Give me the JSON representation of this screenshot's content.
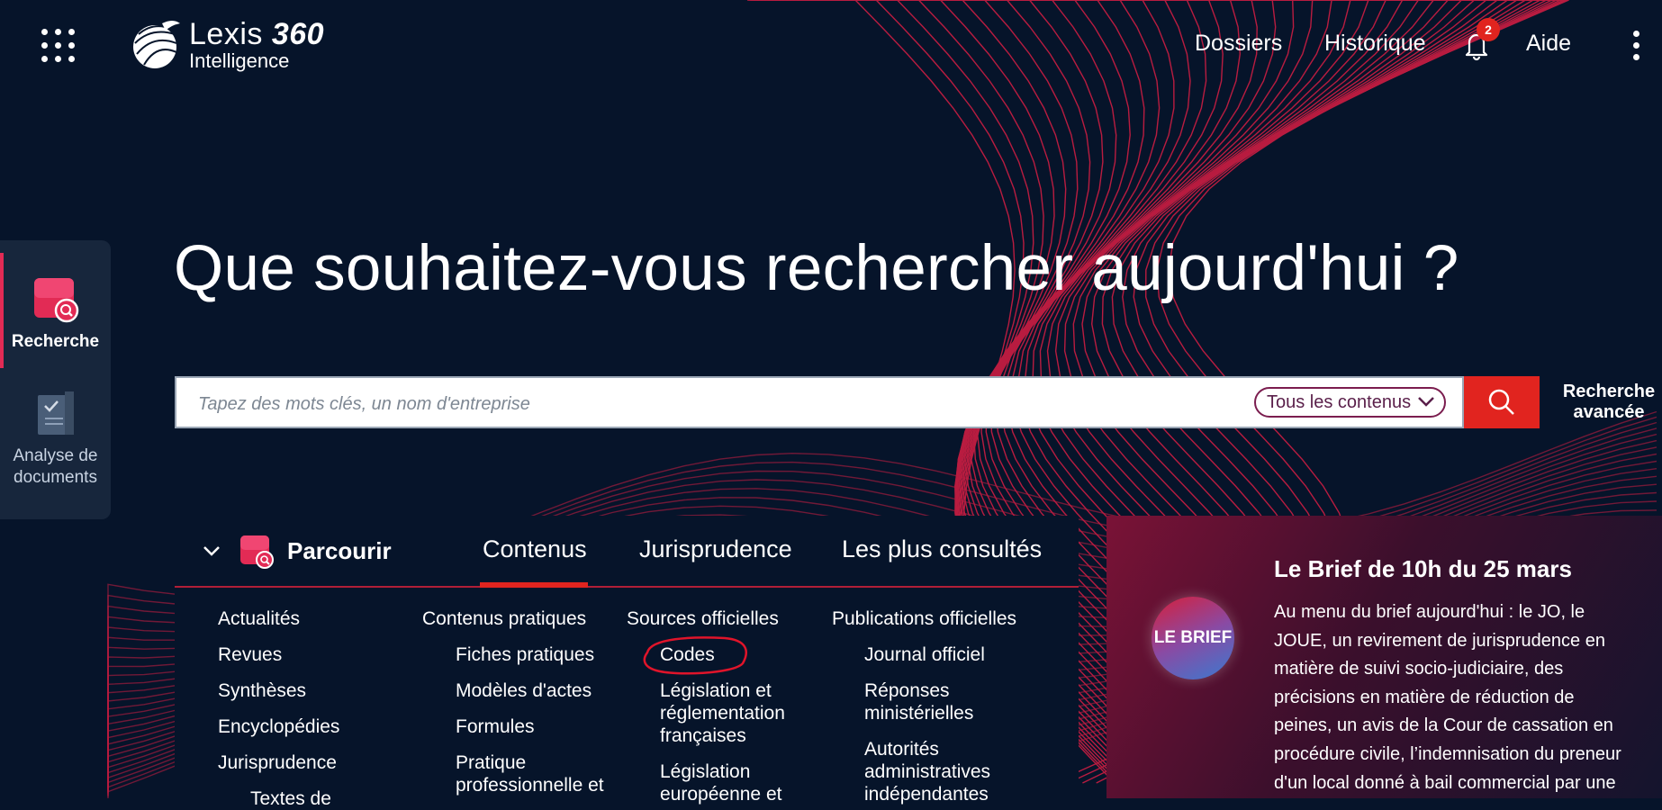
{
  "app": {
    "brand_name": "Lexis",
    "brand_num": "360",
    "brand_sub": "Intelligence"
  },
  "nav": {
    "dossiers": "Dossiers",
    "historique": "Historique",
    "notifications_count": "2",
    "aide": "Aide"
  },
  "sidebar": {
    "items": [
      {
        "label": "Recherche",
        "icon": "search-doc-icon",
        "active": true
      },
      {
        "label_line1": "Analyse de",
        "label_line2": "documents",
        "icon": "document-check-icon",
        "active": false
      }
    ]
  },
  "hero": {
    "headline": "Que souhaitez-vous rechercher aujourd'hui ?"
  },
  "search": {
    "placeholder": "Tapez des mots clés, un nom d'entreprise",
    "scope": "Tous les contenus",
    "advanced_line1": "Recherche",
    "advanced_line2": "avancée"
  },
  "browse": {
    "title": "Parcourir",
    "tabs": [
      {
        "label": "Contenus",
        "active": true
      },
      {
        "label": "Jurisprudence",
        "active": false
      },
      {
        "label": "Les plus consultés",
        "active": false
      }
    ],
    "columns": [
      {
        "items": [
          "Actualités",
          "Revues",
          "Synthèses",
          "Encyclopédies",
          "Jurisprudence",
          "Textes de"
        ]
      },
      {
        "heading": "Contenus pratiques",
        "items": [
          "Fiches pratiques",
          "Modèles d'actes",
          "Formules",
          "Pratique",
          "professionnelle et"
        ]
      },
      {
        "heading": "Sources officielles",
        "items": [
          "Codes",
          "Législation et",
          "réglementation",
          "françaises",
          "Législation",
          "européenne et"
        ]
      },
      {
        "heading": "Publications officielles",
        "items": [
          "Journal officiel",
          "Réponses",
          "ministérielles",
          "Autorités",
          "administratives",
          "indépendantes"
        ]
      }
    ]
  },
  "brief": {
    "badge": "LE BRIEF",
    "title": "Le Brief de 10h du 25 mars",
    "body": "Au menu du brief aujourd'hui : le JO, le JOUE, un revirement de jurisprudence en matière de suivi socio-judiciaire, des précisions en matière de réduction de peines, un avis de la Cour de cassation en procédure civile, l’indemnisation du preneur d'un local donné à bail commercial par une"
  },
  "colors": {
    "background": "#06142a",
    "accent_red": "#e1241f",
    "wave_red": "#d81e44",
    "rail": "#17263c"
  }
}
